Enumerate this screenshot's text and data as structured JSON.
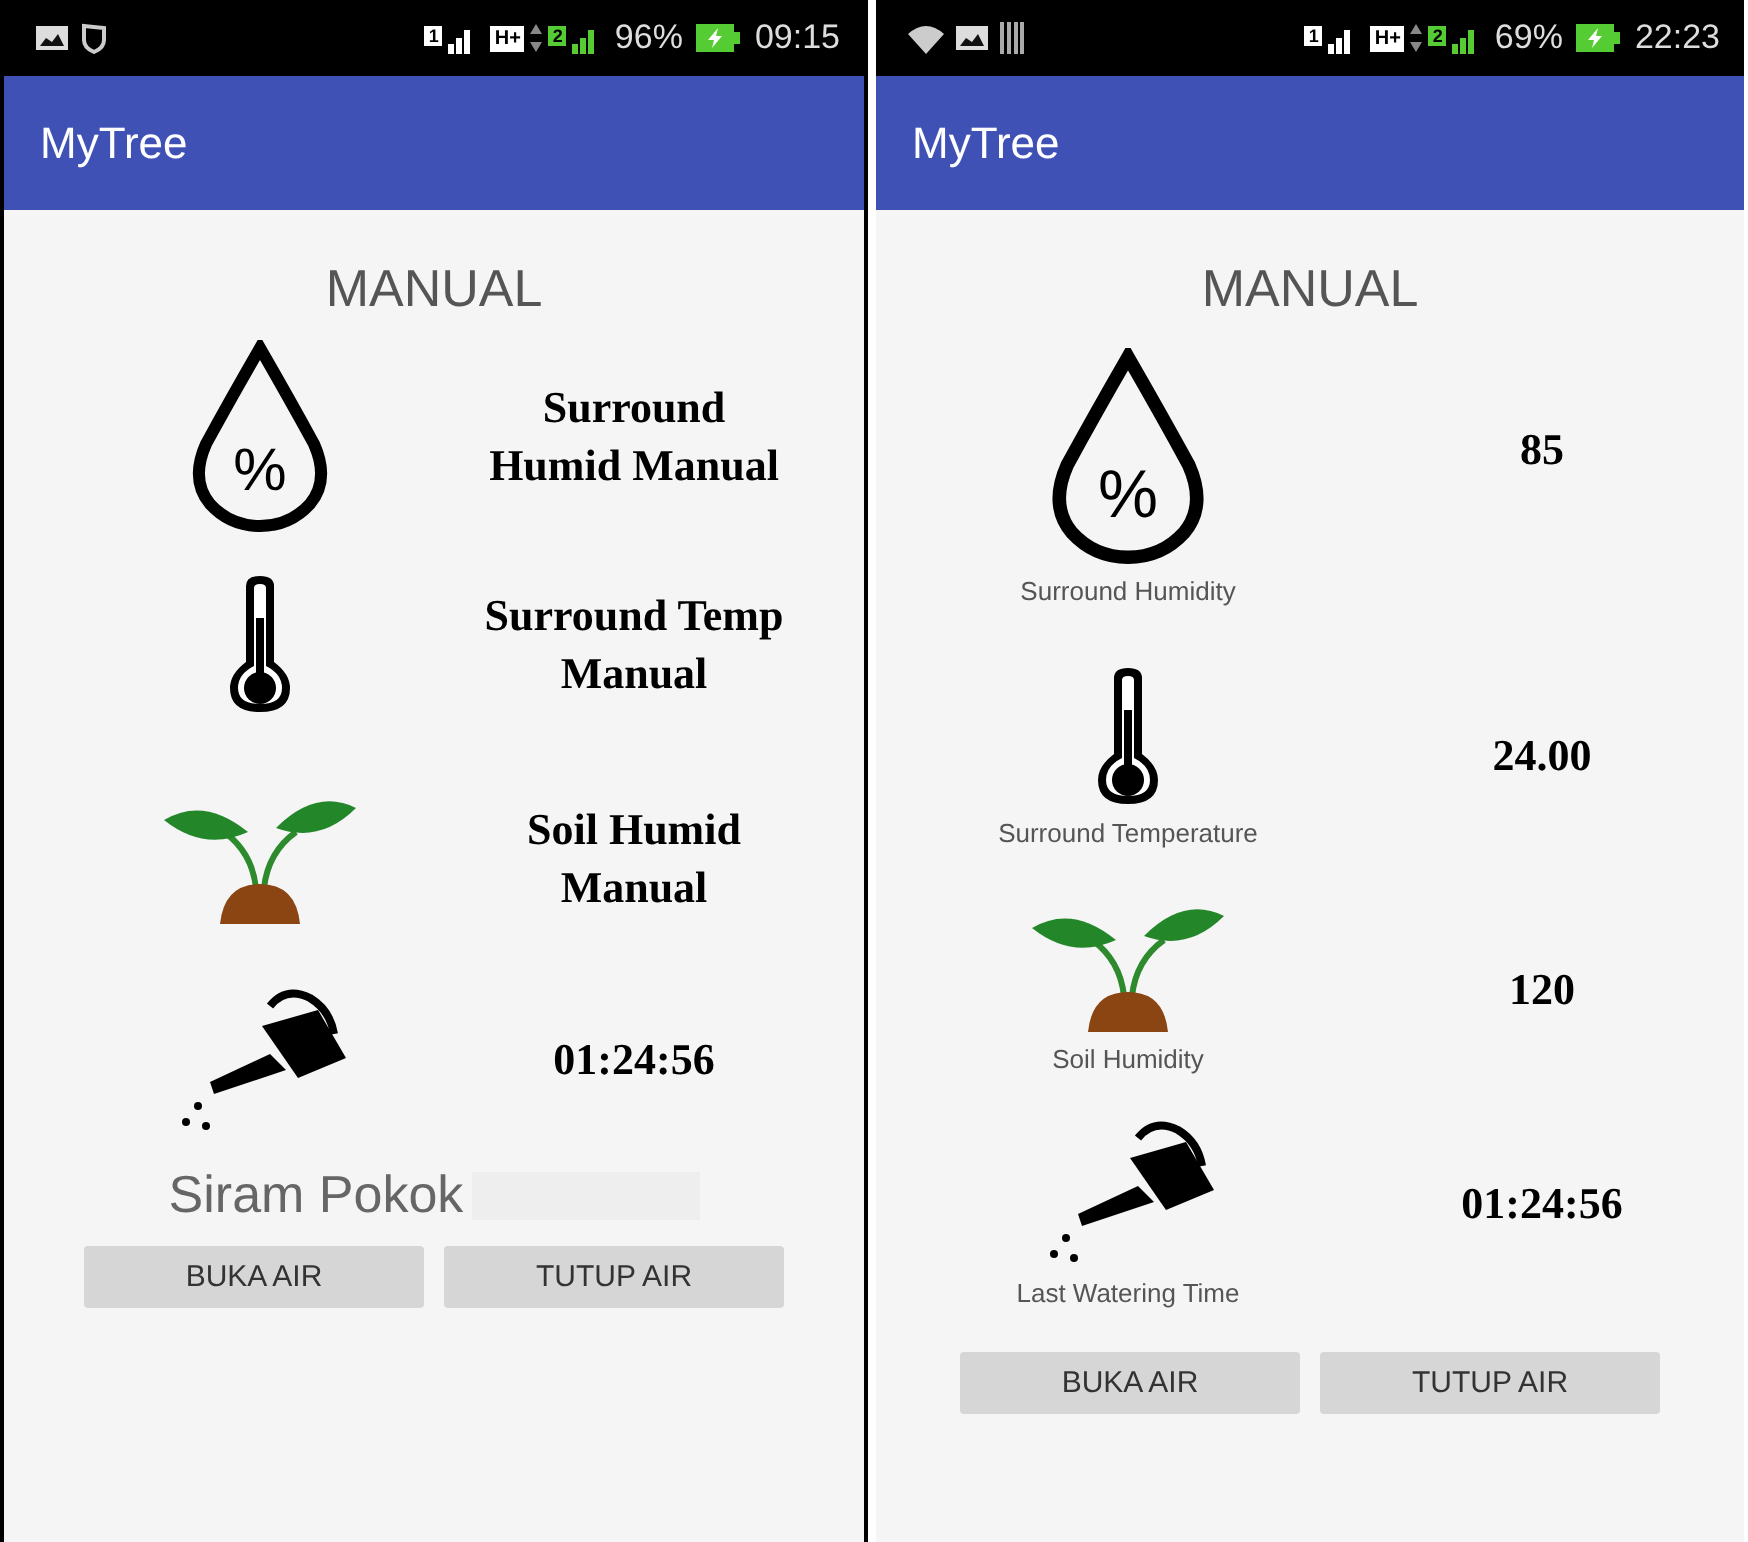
{
  "screens": [
    {
      "status_bar": {
        "left_icons": [
          {
            "kind": "image"
          },
          {
            "kind": "shield"
          }
        ],
        "sim1": "1",
        "network": "H+",
        "sim2": "2",
        "battery": "96%",
        "time": "09:15"
      },
      "app_title": "MyTree",
      "heading": "MANUAL",
      "kind": "labels",
      "rows": [
        {
          "kind": "drop",
          "glyph": "%",
          "text": "Surround Humid Manual"
        },
        {
          "kind": "thermometer",
          "text": "Surround Temp Manual"
        },
        {
          "kind": "sprout",
          "text": "Soil Humid Manual"
        },
        {
          "kind": "watering-can",
          "text": "01:24:56"
        }
      ],
      "footer_label": "Siram Pokok",
      "buttons": [
        "BUKA AIR",
        "TUTUP AIR"
      ]
    },
    {
      "status_bar": {
        "left_icons": [
          {
            "kind": "wifi"
          },
          {
            "kind": "image"
          },
          {
            "kind": "bars"
          }
        ],
        "sim1": "1",
        "network": "H+",
        "sim2": "2",
        "battery": "69%",
        "time": "22:23"
      },
      "app_title": "MyTree",
      "heading": "MANUAL",
      "kind": "readings",
      "rows": [
        {
          "kind": "drop",
          "glyph": "%",
          "caption": "Surround Humidity",
          "text": "85"
        },
        {
          "kind": "thermometer",
          "caption": "Surround Temperature",
          "text": "24.00"
        },
        {
          "kind": "sprout",
          "caption": "Soil Humidity",
          "text": "120"
        },
        {
          "kind": "watering-can",
          "caption": "Last Watering Time",
          "text": "01:24:56"
        }
      ],
      "buttons": [
        "BUKA AIR",
        "TUTUP AIR"
      ]
    }
  ]
}
